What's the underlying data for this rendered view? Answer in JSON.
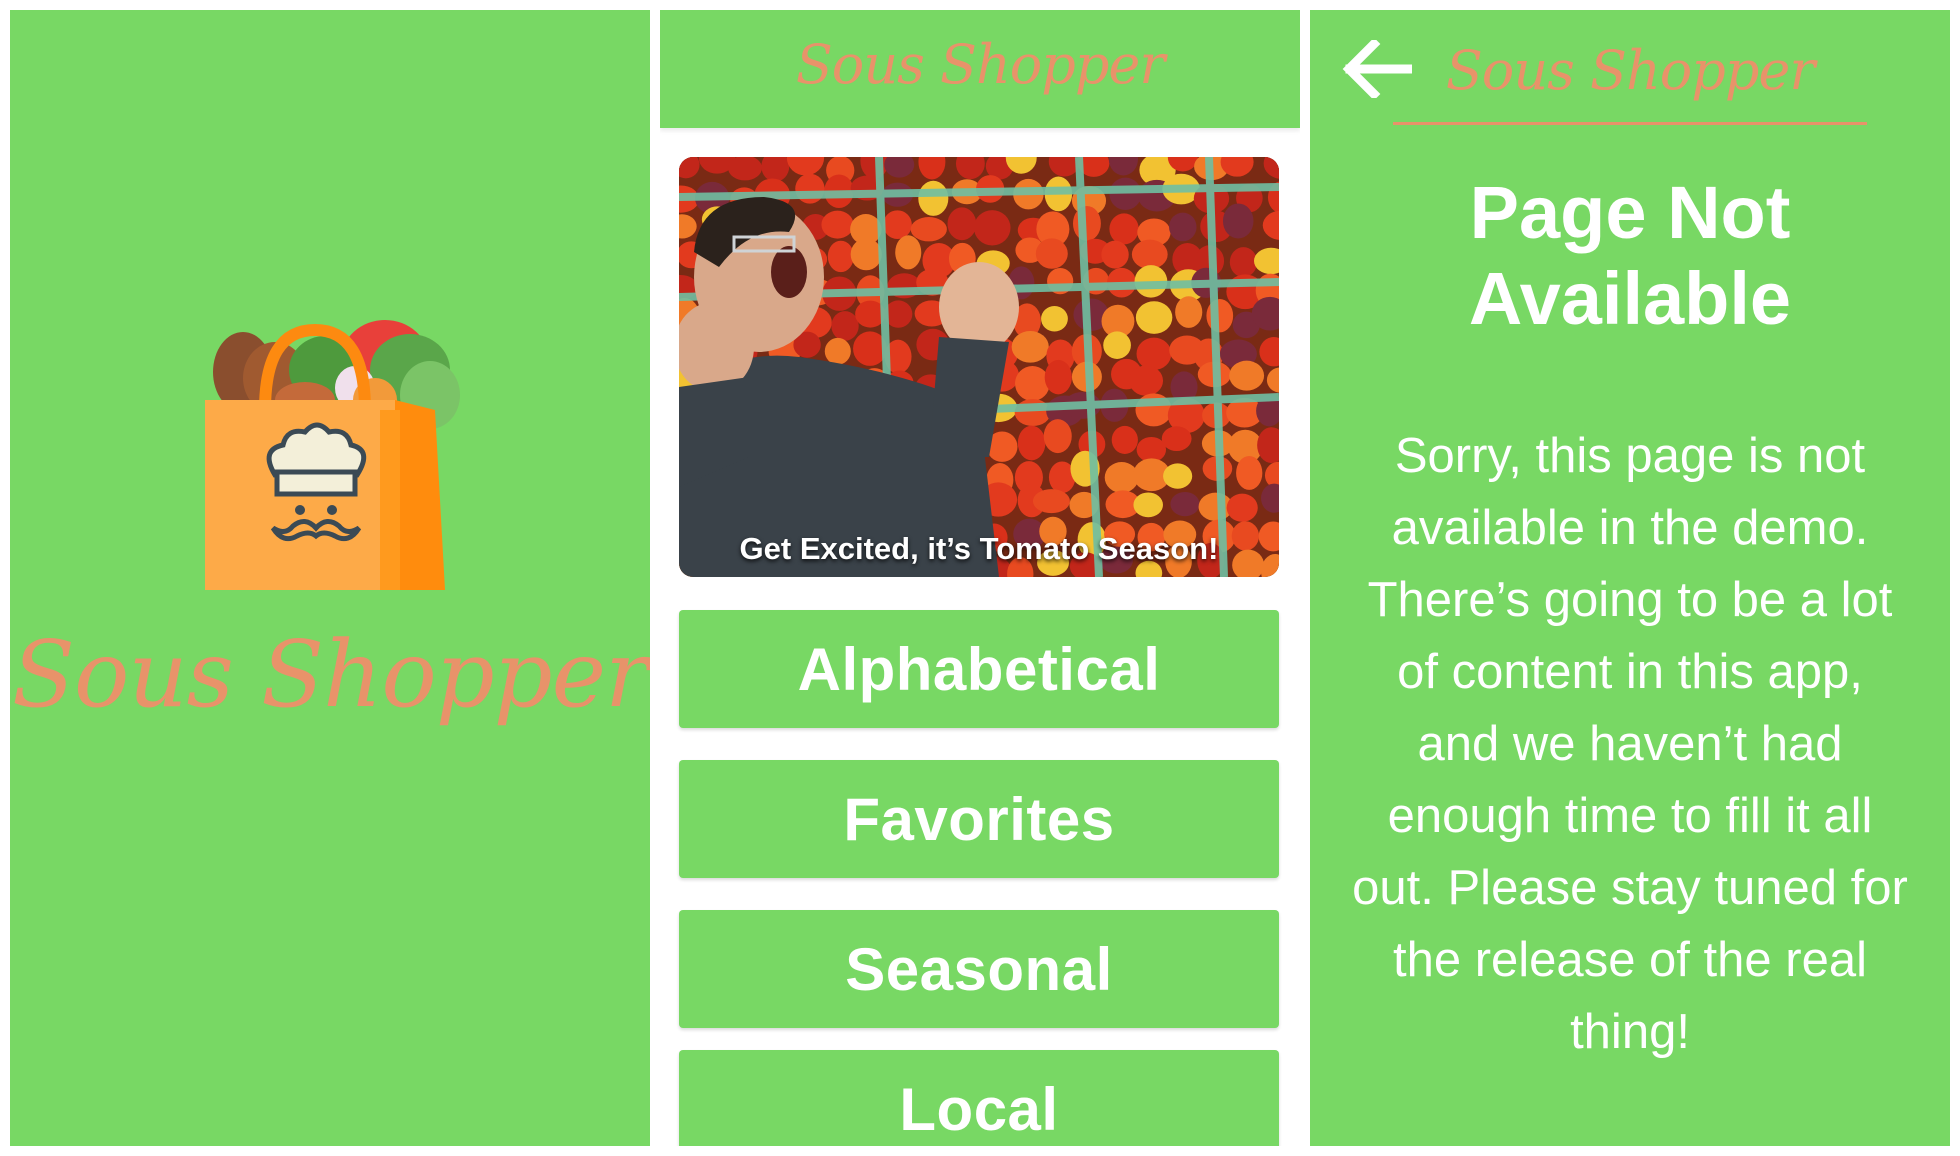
{
  "app": {
    "name": "Sous Shopper"
  },
  "colors": {
    "green": "#78d864",
    "salmon": "#e8936a",
    "white": "#ffffff",
    "bag_orange": "#fdaa48",
    "bag_dark_orange": "#ff8c0d"
  },
  "splash": {
    "logo_icon": "shopping-bag-chef-icon",
    "title": "Sous Shopper"
  },
  "home": {
    "header_title": "Sous Shopper",
    "banner": {
      "caption": "Get Excited, it’s Tomato Season!"
    },
    "menu": [
      {
        "label": "Alphabetical"
      },
      {
        "label": "Favorites"
      },
      {
        "label": "Seasonal"
      },
      {
        "label": "Local"
      }
    ]
  },
  "not_available": {
    "back_icon": "arrow-left-icon",
    "header_title": "Sous Shopper",
    "heading": "Page Not Available",
    "body": "Sorry, this page is not available in the demo. There’s going to be a lot of content in this app, and we haven’t had enough time to fill it all out. Please stay tuned for the release of the real thing!"
  }
}
